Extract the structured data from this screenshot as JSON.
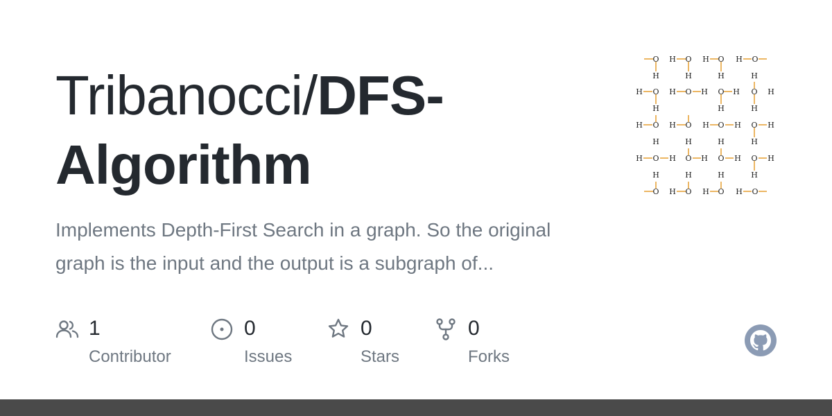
{
  "repo": {
    "owner": "Tribanocci/",
    "name": "DFS-Algorithm",
    "description": "Implements Depth-First Search in a graph. So the original graph is the input and the output is a subgraph of..."
  },
  "stats": [
    {
      "icon": "people-icon",
      "value": "1",
      "label": "Contributor"
    },
    {
      "icon": "issue-circle-icon",
      "value": "0",
      "label": "Issues"
    },
    {
      "icon": "star-icon",
      "value": "0",
      "label": "Stars"
    },
    {
      "icon": "fork-icon",
      "value": "0",
      "label": "Forks"
    }
  ],
  "colors": {
    "title": "#24292f",
    "muted": "#6e7781",
    "bond_accent": "#e8a33c",
    "github_logo": "#8b9bb4",
    "bottom_bar": "#4a4a4a"
  }
}
